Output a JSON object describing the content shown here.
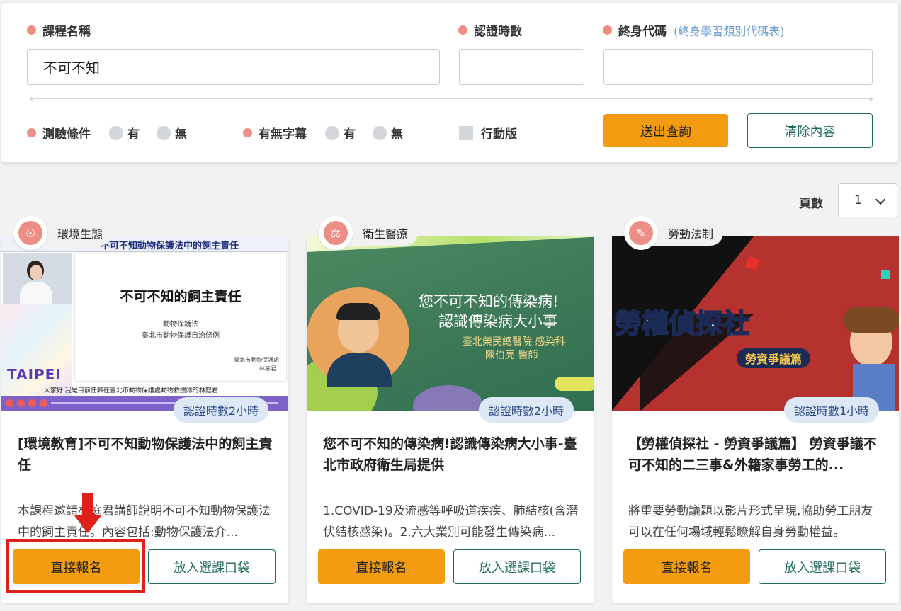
{
  "search": {
    "course_name_label": "課程名稱",
    "course_name_value": "不可不知",
    "hours_label": "認證時數",
    "hours_value": "",
    "code_label": "終身代碼",
    "code_link": "(終身學習類別代碼表)",
    "code_value": "",
    "exam_label": "測驗條件",
    "exam_yes": "有",
    "exam_no": "無",
    "subtitle_label": "有無字幕",
    "subtitle_yes": "有",
    "subtitle_no": "無",
    "mobile_label": "行動版",
    "submit": "送出查詢",
    "clear": "清除內容"
  },
  "pagination": {
    "label": "頁數",
    "value": "1"
  },
  "colors": {
    "accent": "#f39c12",
    "outline": "#1f6b5c",
    "dot": "#ec8e86",
    "hours_bg": "#dde8f6"
  },
  "cards": [
    {
      "category": "環境生態",
      "icon": "user-leaf-icon",
      "hours": "認證時數2小時",
      "thumb_header": "不可不知動物保護法中的飼主責任",
      "thumb_title": "不可不知的飼主責任",
      "thumb_sub1": "動物保護法",
      "thumb_sub2": "臺北市動物保護自治條例",
      "thumb_org": "臺北市動物保護處",
      "thumb_org2": "林庭君",
      "thumb_logo": "TAIPEI",
      "thumb_caption": "大家好 我是目前任職在臺北市動物保護處動物救援隊的林庭君",
      "title": "[環境教育]不可不知動物保護法中的飼主責任",
      "desc": "本課程邀請林庭君講師說明不可不知動物保護法中的飼主責任。內容包括:動物保護法介...",
      "enroll": "直接報名",
      "bag": "放入選課口袋"
    },
    {
      "category": "衛生醫療",
      "icon": "bank-icon",
      "hours": "認證時數2小時",
      "thumb_title1": "您不可不知的傳染病!",
      "thumb_title2": "認識傳染病大小事",
      "thumb_sub1": "臺北榮民總醫院 感染科",
      "thumb_sub2": "陳伯亮 醫師",
      "title": "您不可不知的傳染病!認識傳染病大小事-臺北市政府衛生局提供",
      "desc": "1.COVID-19及流感等呼吸道疾疾、肺結核(含潛伏結核感染)。2.六大業別可能發生傳染病...",
      "enroll": "直接報名",
      "bag": "放入選課口袋"
    },
    {
      "category": "勞動法制",
      "icon": "edit-icon",
      "hours": "認證時數1小時",
      "thumb_title": "勞權偵探社",
      "thumb_sub": "勞資爭議篇",
      "title": "【勞權偵探社 - 勞資爭議篇】 勞資爭議不可不知的二三事&外籍家事勞工的...",
      "desc": "將重要勞動議題以影片形式呈現,協助勞工朋友可以在任何場域輕鬆瞭解自身勞動權益。",
      "enroll": "直接報名",
      "bag": "放入選課口袋"
    }
  ]
}
